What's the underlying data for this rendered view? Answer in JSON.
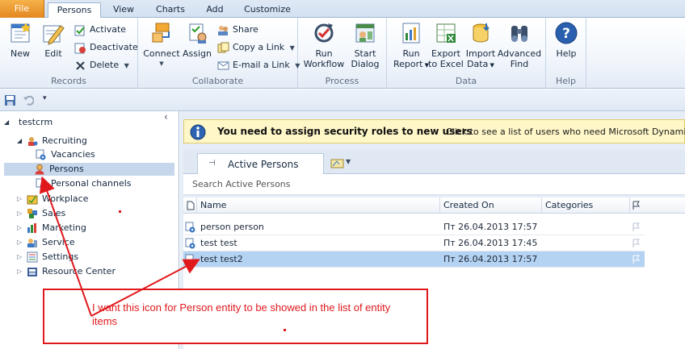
{
  "tabs": [
    "File",
    "Persons",
    "View",
    "Charts",
    "Add",
    "Customize"
  ],
  "ribbon": {
    "records": {
      "label": "Records",
      "new": "New",
      "edit": "Edit",
      "activate": "Activate",
      "deactivate": "Deactivate",
      "delete": "Delete"
    },
    "collaborate": {
      "label": "Collaborate",
      "connect": "Connect",
      "assign": "Assign",
      "share": "Share",
      "copy_link": "Copy a Link",
      "email_link": "E-mail a Link"
    },
    "process": {
      "label": "Process",
      "run_workflow": [
        "Run",
        "Workflow"
      ],
      "start_dialog": [
        "Start",
        "Dialog"
      ]
    },
    "data": {
      "label": "Data",
      "run_report": [
        "Run",
        "Report"
      ],
      "export_excel": [
        "Export",
        "to Excel"
      ],
      "import_data": [
        "Import",
        "Data"
      ],
      "advanced_find": [
        "Advanced",
        "Find"
      ]
    },
    "help": {
      "label": "Help",
      "help": "Help"
    }
  },
  "nav": {
    "root": "testcrm",
    "recruiting": "Recruiting",
    "vacancies": "Vacancies",
    "persons": "Persons",
    "personal_channels": "Personal channels",
    "workplace": "Workplace",
    "sales": "Sales",
    "marketing": "Marketing",
    "service": "Service",
    "settings": "Settings",
    "resource_center": "Resource Center"
  },
  "notification": {
    "bold": "You need to assign security roles to new users",
    "link": "Click to see a list of users who need Microsoft Dynamics CRM s"
  },
  "view": {
    "active_tab": "Active Persons",
    "search_placeholder": "Search Active Persons"
  },
  "grid": {
    "columns": [
      "Name",
      "Created On",
      "Categories"
    ],
    "rows": [
      {
        "name": "person person",
        "created": "Пт 26.04.2013 17:57"
      },
      {
        "name": "test test",
        "created": "Пт 26.04.2013 17:45"
      },
      {
        "name": "test test2",
        "created": "Пт 26.04.2013 17:57"
      }
    ],
    "selected_row": 2
  },
  "annotation": {
    "text": "I want this icon for Person entity to be showed in the list of entity items",
    "color": "#e0181c"
  }
}
